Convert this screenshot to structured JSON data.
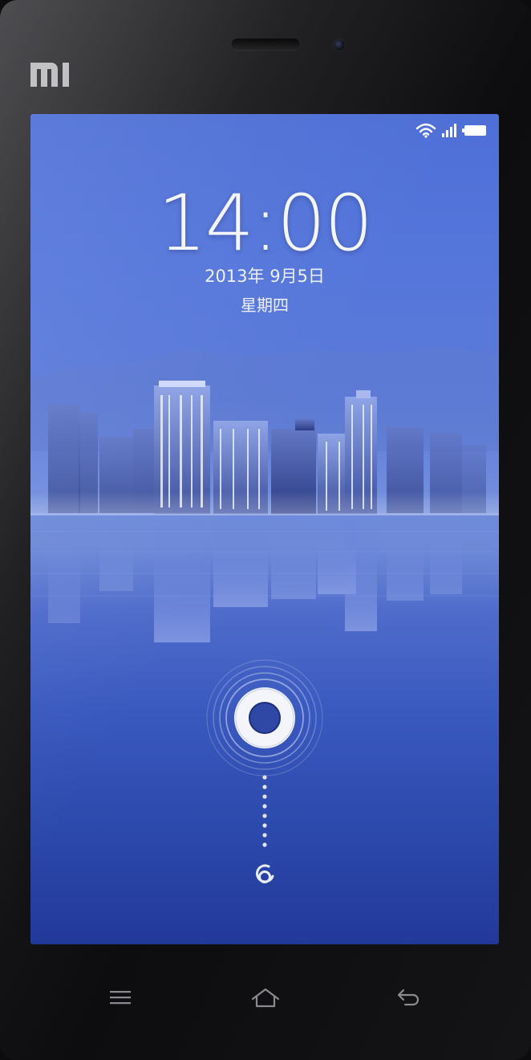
{
  "device": {
    "brand_logo": "MI",
    "icons": [
      "earpiece-speaker",
      "front-camera"
    ]
  },
  "status_bar": {
    "icons": [
      "wifi-icon",
      "signal-icon",
      "battery-icon"
    ]
  },
  "lockscreen": {
    "time": "14:00",
    "date": "2013年 9月5日",
    "weekday": "星期四",
    "unlock_handle_icon": "ring-handle-icon",
    "unlock_target_icon": "unlock-target-icon"
  },
  "nav_keys": [
    {
      "name": "menu",
      "icon": "menu-icon"
    },
    {
      "name": "home",
      "icon": "home-icon"
    },
    {
      "name": "back",
      "icon": "back-icon"
    }
  ],
  "colors": {
    "screen_top": "#4e6fd6",
    "screen_bottom": "#22399a",
    "text": "#f4f6fb",
    "bezel": "#0d0d0f"
  }
}
